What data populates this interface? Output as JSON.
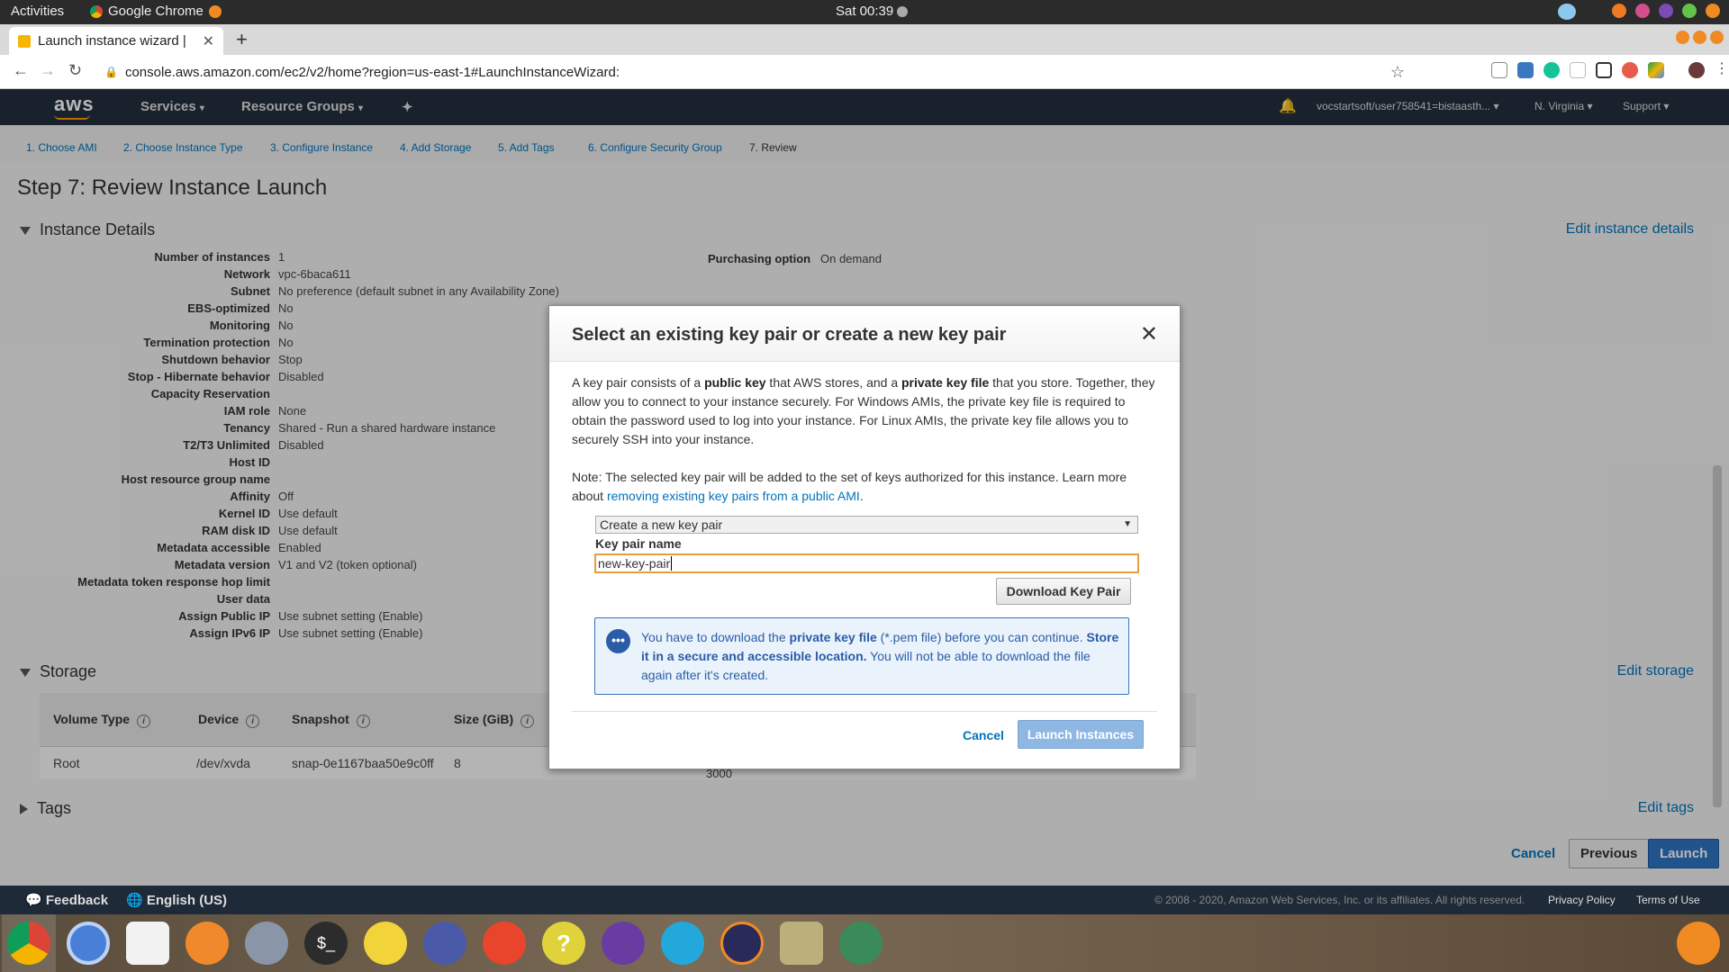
{
  "gnome": {
    "activities": "Activities",
    "app": "Google Chrome",
    "clock": "Sat 00:39"
  },
  "browser": {
    "tab_title": "Launch instance wizard | E",
    "url": "console.aws.amazon.com/ec2/v2/home?region=us-east-1#LaunchInstanceWizard:"
  },
  "aws_nav": {
    "logo": "aws",
    "services": "Services",
    "resource_groups": "Resource Groups",
    "account": "vocstartsoft/user758541=bistaasth...",
    "region": "N. Virginia",
    "support": "Support"
  },
  "wizard_steps": [
    "1. Choose AMI",
    "2. Choose Instance Type",
    "3. Configure Instance",
    "4. Add Storage",
    "5. Add Tags",
    "6. Configure Security Group",
    "7. Review"
  ],
  "page": {
    "title": "Step 7: Review Instance Launch",
    "instance_details": "Instance Details",
    "edit_instance_details": "Edit instance details",
    "purchasing_label": "Purchasing option",
    "purchasing_value": "On demand",
    "storage": "Storage",
    "edit_storage": "Edit storage",
    "tags": "Tags",
    "edit_tags": "Edit tags"
  },
  "details": [
    {
      "k": "Number of instances",
      "v": "1"
    },
    {
      "k": "Network",
      "v": "vpc-6baca611"
    },
    {
      "k": "Subnet",
      "v": "No preference (default subnet in any Availability Zone)"
    },
    {
      "k": "EBS-optimized",
      "v": "No"
    },
    {
      "k": "Monitoring",
      "v": "No"
    },
    {
      "k": "Termination protection",
      "v": "No"
    },
    {
      "k": "Shutdown behavior",
      "v": "Stop"
    },
    {
      "k": "Stop - Hibernate behavior",
      "v": "Disabled"
    },
    {
      "k": "Capacity Reservation",
      "v": ""
    },
    {
      "k": "IAM role",
      "v": "None"
    },
    {
      "k": "Tenancy",
      "v": "Shared - Run a shared hardware instance"
    },
    {
      "k": "T2/T3 Unlimited",
      "v": "Disabled"
    },
    {
      "k": "Host ID",
      "v": ""
    },
    {
      "k": "Host resource group name",
      "v": ""
    },
    {
      "k": "Affinity",
      "v": "Off"
    },
    {
      "k": "Kernel ID",
      "v": "Use default"
    },
    {
      "k": "RAM disk ID",
      "v": "Use default"
    },
    {
      "k": "Metadata accessible",
      "v": "Enabled"
    },
    {
      "k": "Metadata version",
      "v": "V1 and V2 (token optional)"
    },
    {
      "k": "Metadata token response hop limit",
      "v": ""
    },
    {
      "k": "User data",
      "v": ""
    },
    {
      "k": "Assign Public IP",
      "v": "Use subnet setting (Enable)"
    },
    {
      "k": "Assign IPv6 IP",
      "v": "Use subnet setting (Enable)"
    }
  ],
  "storage_table": {
    "headers": [
      "Volume Type",
      "Device",
      "Snapshot",
      "Size (GiB)"
    ],
    "row": [
      "Root",
      "/dev/xvda",
      "snap-0e1167baa50e9c0ff",
      "8"
    ],
    "partial": "3000"
  },
  "actions": {
    "cancel": "Cancel",
    "previous": "Previous",
    "launch": "Launch"
  },
  "modal": {
    "title": "Select an existing key pair or create a new key pair",
    "p1_a": "A key pair consists of a ",
    "p1_b": "public key",
    "p1_c": " that AWS stores, and a ",
    "p1_d": "private key file",
    "p1_e": " that you store. Together, they allow you to connect to your instance securely. For Windows AMIs, the private key file is required to obtain the password used to log into your instance. For Linux AMIs, the private key file allows you to securely SSH into your instance.",
    "note_a": "Note: The selected key pair will be added to the set of keys authorized for this instance. Learn more about ",
    "note_link": "removing existing key pairs from a public AMI",
    "note_b": ".",
    "select_value": "Create a new key pair",
    "key_label": "Key pair name",
    "key_value": "new-key-pair",
    "download": "Download Key Pair",
    "info_a": "You have to download the ",
    "info_b": "private key file",
    "info_c": " (*.pem file) before you can continue. ",
    "info_d": "Store it in a secure and accessible location.",
    "info_e": " You will not be able to download the file again after it's created.",
    "cancel": "Cancel",
    "launch": "Launch Instances"
  },
  "footer": {
    "feedback": "Feedback",
    "language": "English (US)",
    "copyright": "© 2008 - 2020, Amazon Web Services, Inc. or its affiliates. All rights reserved.",
    "privacy": "Privacy Policy",
    "terms": "Terms of Use"
  },
  "colors": {
    "aws_nav": "#232f3e",
    "link": "#0073bb",
    "launch_btn": "#2e73c4",
    "orange": "#f90"
  }
}
